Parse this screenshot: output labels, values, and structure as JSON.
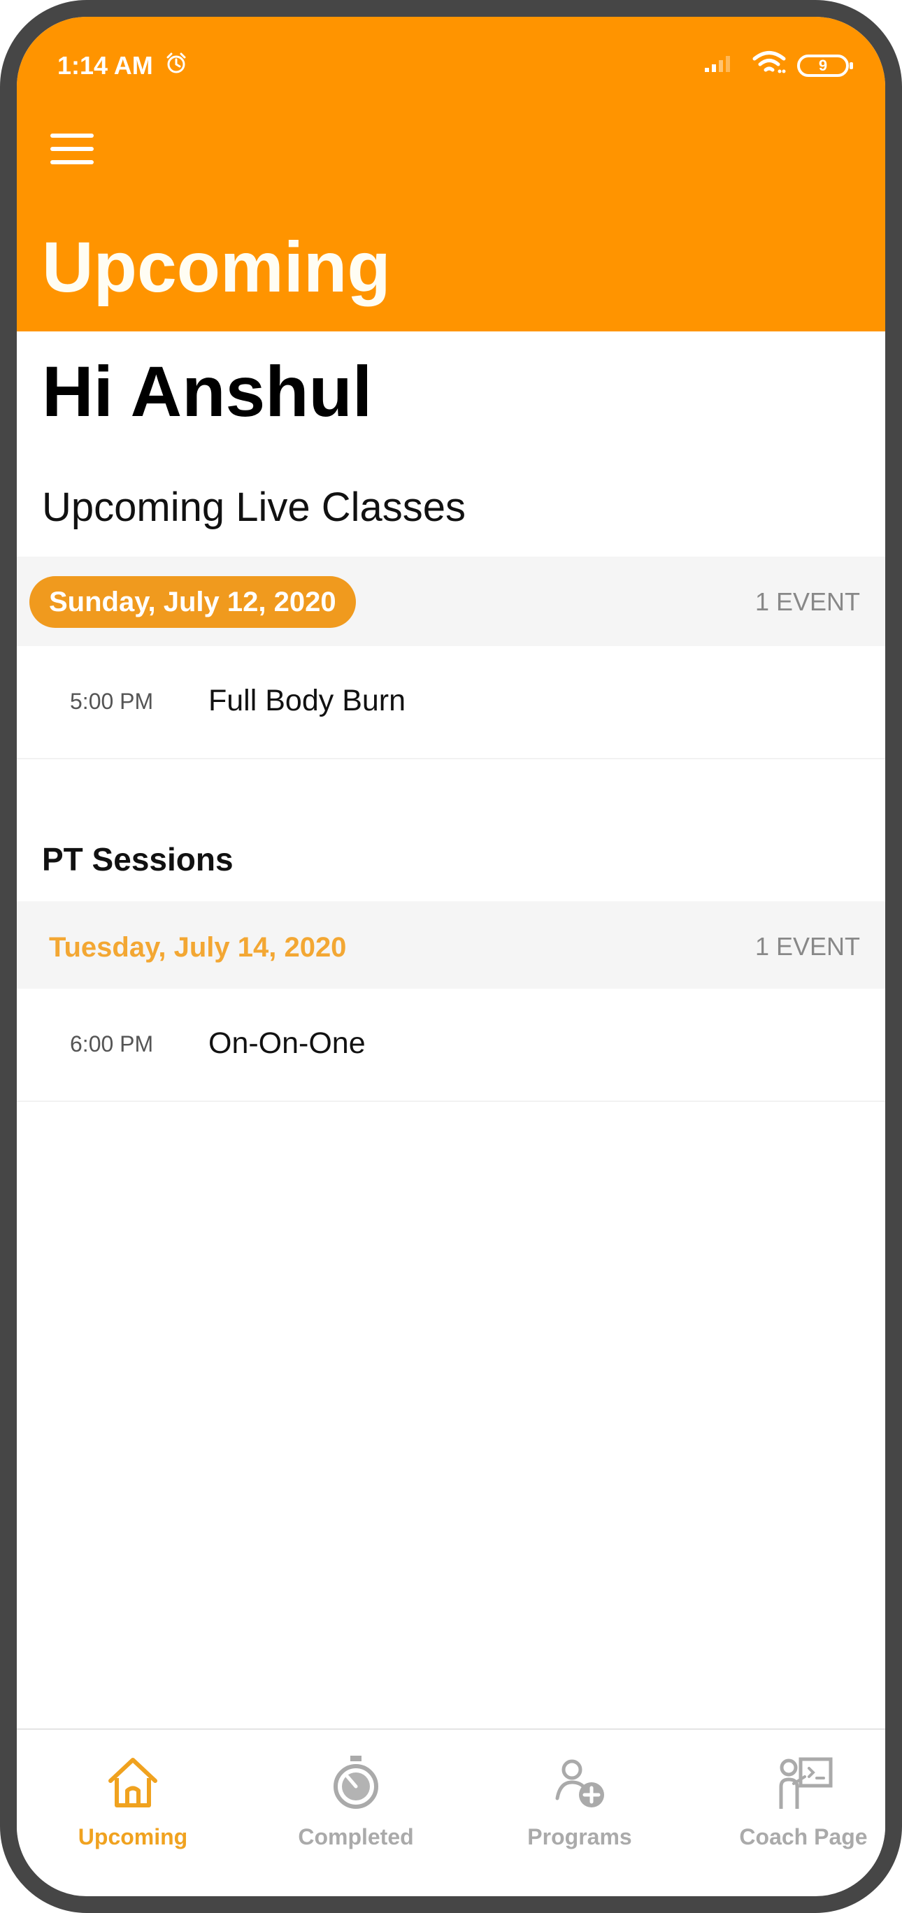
{
  "status_bar": {
    "time": "1:14 AM",
    "alarm_icon": "alarm-clock-icon",
    "battery": "9"
  },
  "header": {
    "menu_icon": "hamburger-menu-icon",
    "title": "Upcoming"
  },
  "greeting": "Hi Anshul",
  "live_classes": {
    "title": "Upcoming Live Classes",
    "groups": [
      {
        "date": "Sunday, July 12, 2020",
        "count": "1 EVENT",
        "events": [
          {
            "time": "5:00 PM",
            "name": "Full Body Burn"
          }
        ]
      }
    ]
  },
  "pt_sessions": {
    "title": "PT Sessions",
    "groups": [
      {
        "date": "Tuesday, July 14, 2020",
        "count": "1 EVENT",
        "events": [
          {
            "time": "6:00 PM",
            "name": "On-On-One"
          }
        ]
      }
    ]
  },
  "bottom_nav": [
    {
      "label": "Upcoming",
      "icon": "home-icon",
      "active": true
    },
    {
      "label": "Completed",
      "icon": "stopwatch-icon",
      "active": false
    },
    {
      "label": "Programs",
      "icon": "user-add-icon",
      "active": false
    },
    {
      "label": "Coach Page",
      "icon": "coach-board-icon",
      "active": false
    }
  ],
  "colors": {
    "brand_orange": "#ff9400",
    "date_pill": "#f09a1e",
    "inactive_nav": "#aaaaaa"
  }
}
